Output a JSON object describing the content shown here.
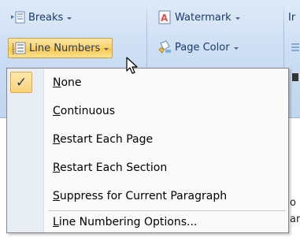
{
  "ribbon": {
    "breaks": {
      "label": "Breaks",
      "icon": "breaks-icon"
    },
    "line_numbers": {
      "label": "Line Numbers",
      "icon": "line-numbers-icon"
    },
    "watermark": {
      "label": "Watermark",
      "icon": "watermark-icon"
    },
    "page_color": {
      "label": "Page Color",
      "icon": "page-color-icon"
    },
    "cut_label": "Ir"
  },
  "menu": {
    "items": [
      {
        "first": "N",
        "rest": "one",
        "checked": true
      },
      {
        "first": "C",
        "rest": "ontinuous",
        "checked": false
      },
      {
        "first": "R",
        "rest": "estart Each Page",
        "checked": false
      },
      {
        "first": "R",
        "rest": "estart Each Section",
        "checked": false
      },
      {
        "first": "S",
        "rest": "uppress for Current Paragraph",
        "checked": false
      },
      {
        "first": "L",
        "rest": "ine Numbering Options...",
        "checked": false
      }
    ],
    "check_glyph": "✓"
  },
  "document": {
    "fragment_1": "o",
    "fragment_2": "ar"
  },
  "colors": {
    "highlight": "#fcd27a",
    "check_border": "#e3a64a",
    "gutter": "#e9eef5"
  }
}
